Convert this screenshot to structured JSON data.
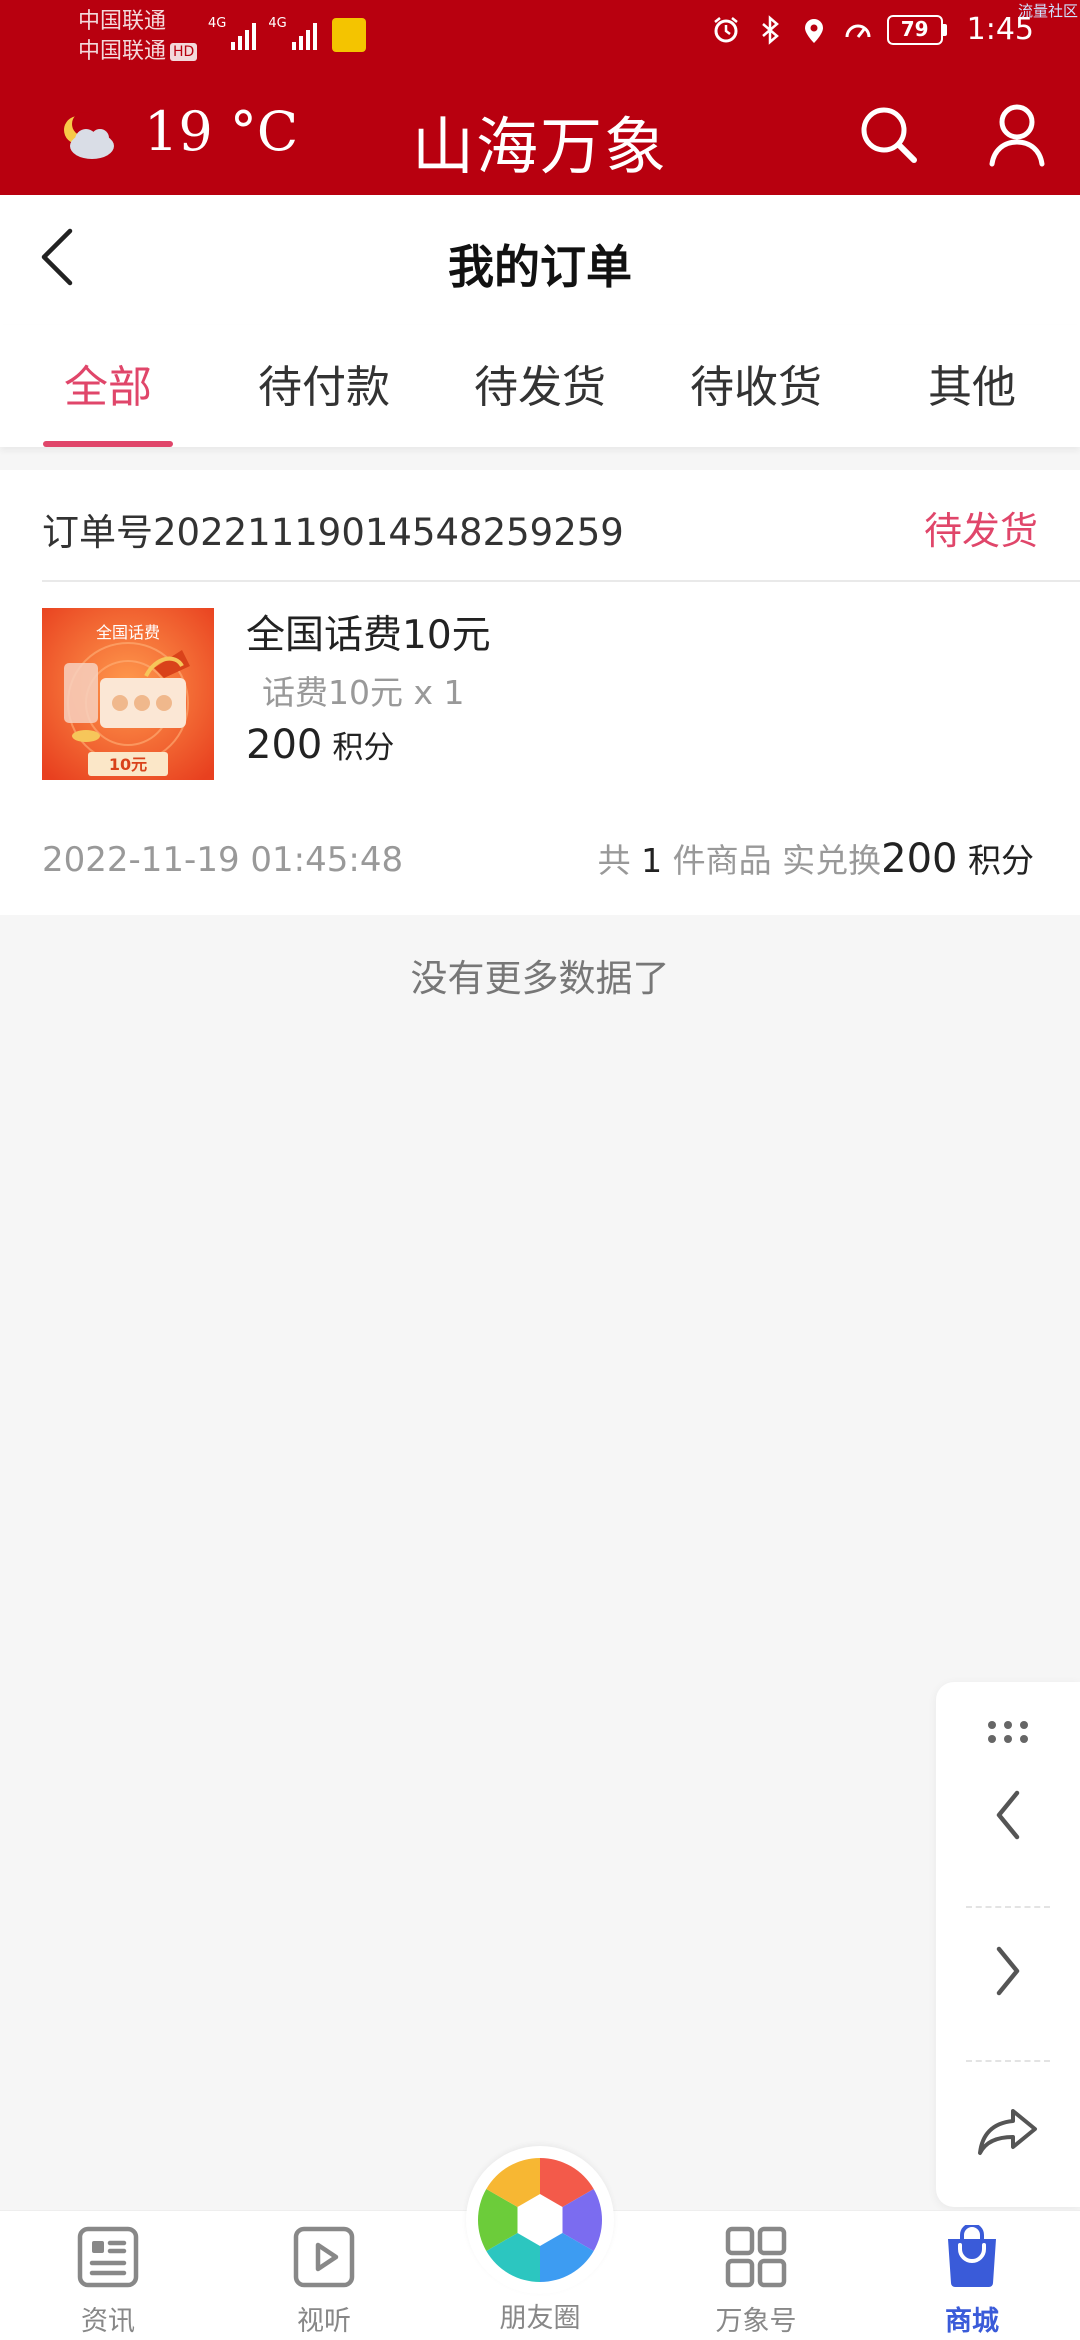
{
  "status_bar": {
    "carrier_1": "中国联通",
    "carrier_2": "中国联通",
    "hd_badge": "HD",
    "network_1": "4G",
    "network_2": "4G",
    "battery": "79",
    "time": "1:45",
    "corner_label": "流量社区"
  },
  "header": {
    "temperature": "19 °C",
    "weather_icon": "cloudy-moon-icon",
    "app_title": "山海万象",
    "search_icon": "search-icon",
    "user_icon": "user-icon"
  },
  "page": {
    "title": "我的订单"
  },
  "tabs": [
    {
      "label": "全部",
      "active": true
    },
    {
      "label": "待付款",
      "active": false
    },
    {
      "label": "待发货",
      "active": false
    },
    {
      "label": "待收货",
      "active": false
    },
    {
      "label": "其他",
      "active": false
    }
  ],
  "order": {
    "order_number": "订单号2022111901454825​9259",
    "status": "待发货",
    "product": {
      "image_badge_title": "全国话费",
      "image_badge_value": "10元",
      "name": "全国话费10元",
      "spec": "话费10元 x 1",
      "points": "200",
      "points_unit": "积分"
    },
    "time": "2022-11-19 01:45:48",
    "summary": {
      "prefix": "共",
      "count": "1",
      "middle": "件商品 实兑换",
      "total": "200",
      "unit": "积分"
    }
  },
  "list_end_text": "没有更多数据了",
  "side_panel": {
    "more_icon": "more-dots-icon",
    "back_icon": "chevron-left-icon",
    "forward_icon": "chevron-right-icon",
    "share_icon": "share-icon"
  },
  "bottom_nav": [
    {
      "label": "资讯",
      "icon": "news-icon",
      "active": false
    },
    {
      "label": "视听",
      "icon": "play-icon",
      "active": false
    },
    {
      "label": "朋友圈",
      "icon": "aperture-icon",
      "active": false
    },
    {
      "label": "万象号",
      "icon": "grid-icon",
      "active": false
    },
    {
      "label": "商城",
      "icon": "shopping-bag-icon",
      "active": true
    }
  ],
  "colors": {
    "header_red": "#b8000f",
    "accent_pink": "#e0466a",
    "nav_active_blue": "#3a5bd9"
  }
}
